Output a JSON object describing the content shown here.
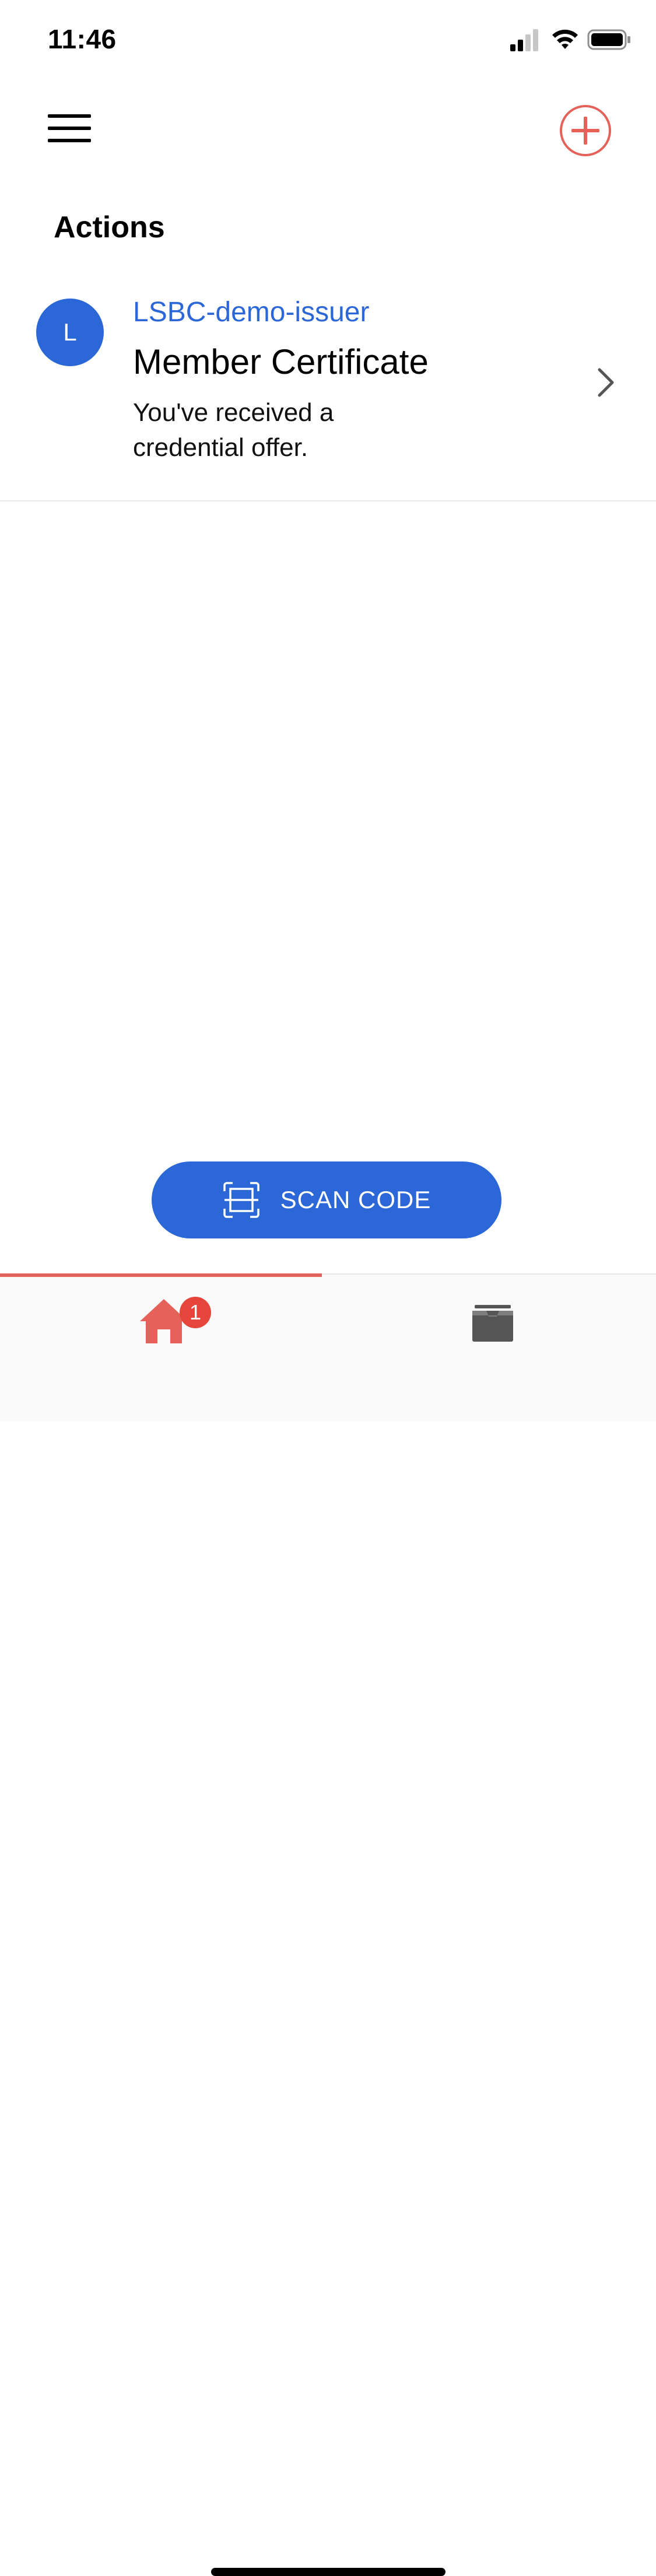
{
  "status_bar": {
    "time": "11:46"
  },
  "header": {
    "menu_icon": "hamburger-menu-icon",
    "add_icon": "plus-circle-icon",
    "accent_color": "#e5625a"
  },
  "actions": {
    "title": "Actions",
    "items": [
      {
        "avatar_letter": "L",
        "issuer": "LSBC-demo-issuer",
        "title": "Member Certificate",
        "description": "You've received a credential offer."
      }
    ]
  },
  "scan_button": {
    "label": "SCAN CODE",
    "icon": "scan-frame-icon",
    "color": "#2b67d6"
  },
  "tab_bar": {
    "tabs": [
      {
        "name": "home",
        "icon": "home-icon",
        "badge": "1",
        "active": true
      },
      {
        "name": "credentials",
        "icon": "wallet-icon",
        "active": false
      }
    ]
  }
}
